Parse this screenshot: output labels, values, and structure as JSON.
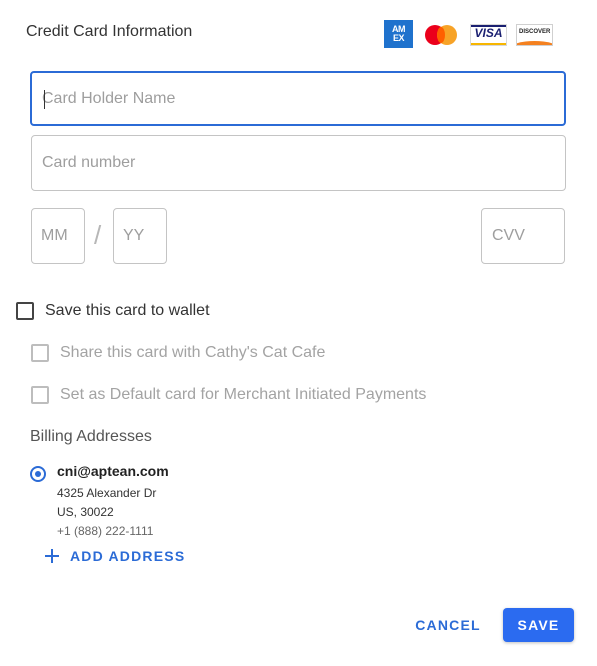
{
  "header": {
    "title": "Credit Card Information",
    "card_brands": [
      {
        "name": "amex-logo",
        "text_top": "AM",
        "text_bottom": "EX"
      },
      {
        "name": "mastercard-logo"
      },
      {
        "name": "visa-logo",
        "text": "VISA"
      },
      {
        "name": "discover-logo",
        "text": "DISCOVER"
      }
    ]
  },
  "form": {
    "card_holder_placeholder": "Card Holder Name",
    "card_number_placeholder": "Card number",
    "month_placeholder": "MM",
    "separator": "/",
    "year_placeholder": "YY",
    "cvv_placeholder": "CVV"
  },
  "options": {
    "save_to_wallet": {
      "label": "Save this card to wallet",
      "checked": false,
      "disabled": false
    },
    "share_card": {
      "label": "Share this card with Cathy's Cat Cafe",
      "checked": false,
      "disabled": true
    },
    "set_default": {
      "label": "Set as Default card for Merchant Initiated Payments",
      "checked": false,
      "disabled": true
    }
  },
  "billing": {
    "section_label": "Billing Addresses",
    "addresses": [
      {
        "email": "cni@aptean.com",
        "street": "4325 Alexander Dr",
        "region": "US, 30022",
        "phone": "+1 (888) 222-1111",
        "selected": true
      }
    ],
    "add_address_label": "ADD ADDRESS"
  },
  "actions": {
    "cancel_label": "CANCEL",
    "save_label": "SAVE"
  },
  "colors": {
    "primary": "#2b6bd6",
    "primary_button": "#2b6bf0",
    "disabled_text": "#a3a3a3"
  }
}
